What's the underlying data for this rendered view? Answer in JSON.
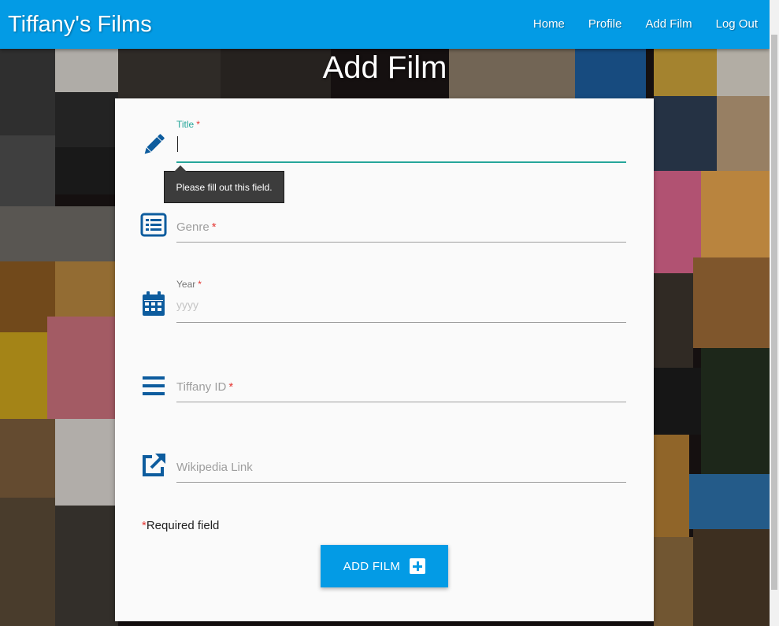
{
  "nav": {
    "brand": "Tiffany's Films",
    "links": [
      "Home",
      "Profile",
      "Add Film",
      "Log Out"
    ]
  },
  "page": {
    "heading": "Add Film"
  },
  "form": {
    "title": {
      "label": "Title",
      "value": "",
      "tooltip": "Please fill out this field."
    },
    "genre": {
      "label": "Genre"
    },
    "year": {
      "label": "Year",
      "placeholder": "yyyy"
    },
    "tiffany_id": {
      "label": "Tiffany ID"
    },
    "wikipedia": {
      "label": "Wikipedia Link"
    },
    "required_marker": "*",
    "required_note": "Required field",
    "submit_label": "ADD FILM"
  },
  "colors": {
    "primary": "#039be5",
    "focus": "#26a69a",
    "icon": "#0d5c9e",
    "required": "#e53935"
  },
  "icons": [
    "pencil-icon",
    "list-icon",
    "calendar-icon",
    "bars-icon",
    "external-link-icon",
    "plus-square-icon"
  ]
}
